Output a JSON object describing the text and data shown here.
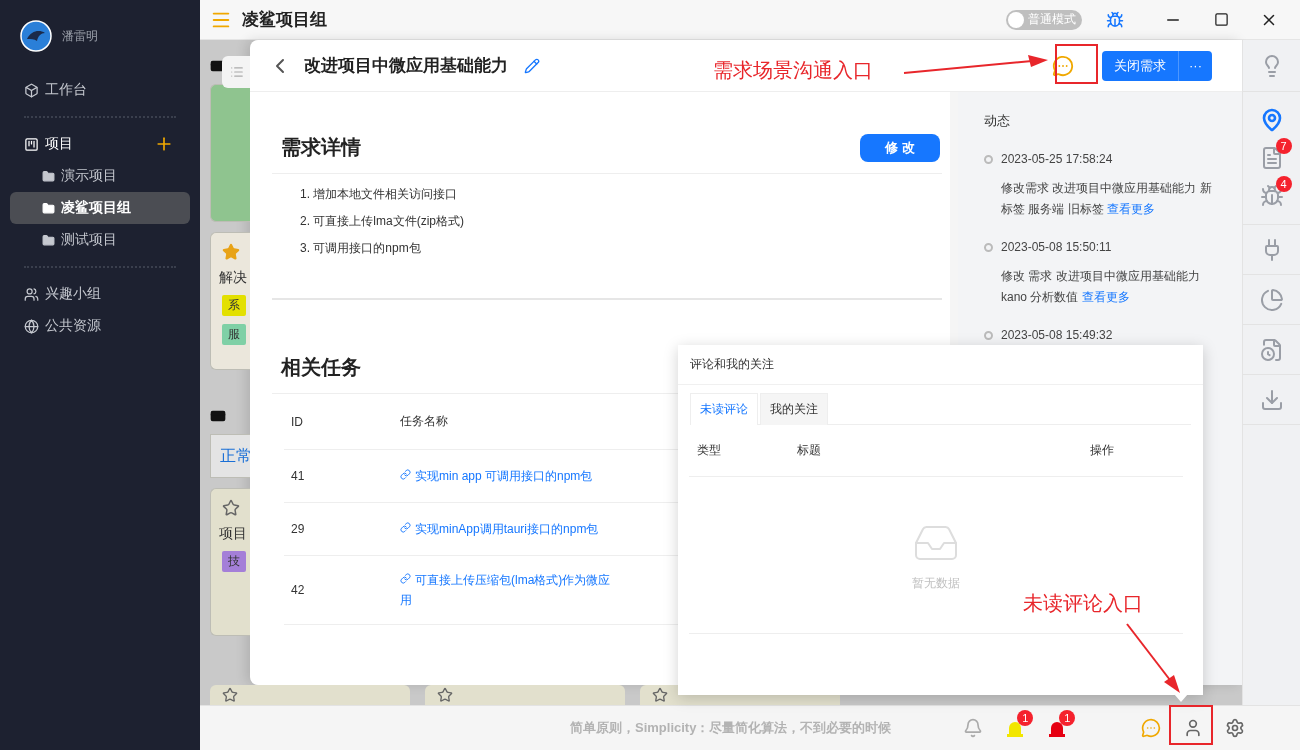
{
  "sidebar": {
    "user_name": "潘雷明",
    "workbench": "工作台",
    "projects": {
      "label": "项目",
      "children": [
        {
          "label": "演示项目",
          "selected": false
        },
        {
          "label": "凌鲨项目组",
          "selected": true
        },
        {
          "label": "测试项目",
          "selected": false
        }
      ]
    },
    "links": [
      "兴趣小组",
      "公共资源"
    ]
  },
  "top_bar": {
    "title": "凌鲨项目组",
    "mode_switch": {
      "label": "普通模式",
      "on": false
    }
  },
  "board": {
    "cards": [
      {
        "title": "解决",
        "starred": true,
        "tags": [
          {
            "label": "系",
            "color": "#e3e000"
          },
          {
            "label": "服",
            "color": "#7fd0a6"
          }
        ]
      },
      {
        "title": "项目",
        "starred": false,
        "tags": [
          {
            "label": "技",
            "color": "#a47fd8"
          }
        ]
      }
    ],
    "filter_tab": "正常"
  },
  "drawer": {
    "title": "改进项目中微应用基础能力",
    "close_button": "关闭需求",
    "more_button": "···",
    "details": {
      "heading": "需求详情",
      "edit_button": "修 改",
      "items": [
        "1. 增加本地文件相关访问接口",
        "2. 可直接上传lma文件(zip格式)",
        "3. 可调用接口的npm包"
      ]
    },
    "tasks": {
      "heading": "相关任务",
      "columns": [
        "ID",
        "任务名称"
      ],
      "rows": [
        {
          "id": "41",
          "name": "实现min app 可调用接口的npm包"
        },
        {
          "id": "29",
          "name": "实现minApp调用tauri接口的npm包"
        },
        {
          "id": "42",
          "name": "可直接上传压缩包(lma格式)作为微应用"
        }
      ]
    }
  },
  "activity": {
    "heading": "动态",
    "entries": [
      {
        "time": "2023-05-25 17:58:24",
        "text": "修改需求 改进项目中微应用基础能力 新标签 服务端 旧标签",
        "link": "查看更多"
      },
      {
        "time": "2023-05-08 15:50:11",
        "text": "修改 需求 改进项目中微应用基础能力 kano 分析数值",
        "link": "查看更多"
      },
      {
        "time": "2023-05-08 15:49:32"
      }
    ]
  },
  "tool_groups": [
    [
      {
        "selected": false
      }
    ],
    [
      {
        "selected": true
      },
      {
        "selected": false,
        "badge": "7"
      },
      {
        "selected": false,
        "badge": "4"
      }
    ],
    [
      {
        "selected": false
      }
    ],
    [
      {
        "selected": false
      }
    ],
    [
      {
        "selected": false
      }
    ],
    [
      {
        "selected": false
      }
    ]
  ],
  "popup": {
    "title": "评论和我的关注",
    "tabs": [
      {
        "label": "未读评论",
        "selected": true
      },
      {
        "label": "我的关注",
        "selected": false
      }
    ],
    "columns": [
      "类型",
      "标题",
      "操作"
    ],
    "empty_text": "暂无数据"
  },
  "status_bar": {
    "motto": "简单原则，Simplicity：尽量简化算法，不到必要的时候",
    "alerts": [
      {
        "badge": "1",
        "color": "#f2e600"
      },
      {
        "badge": "1",
        "color": "#e60012"
      }
    ]
  },
  "annotations": [
    {
      "text": "需求场景沟通入口"
    },
    {
      "text": "未读评论入口"
    }
  ]
}
